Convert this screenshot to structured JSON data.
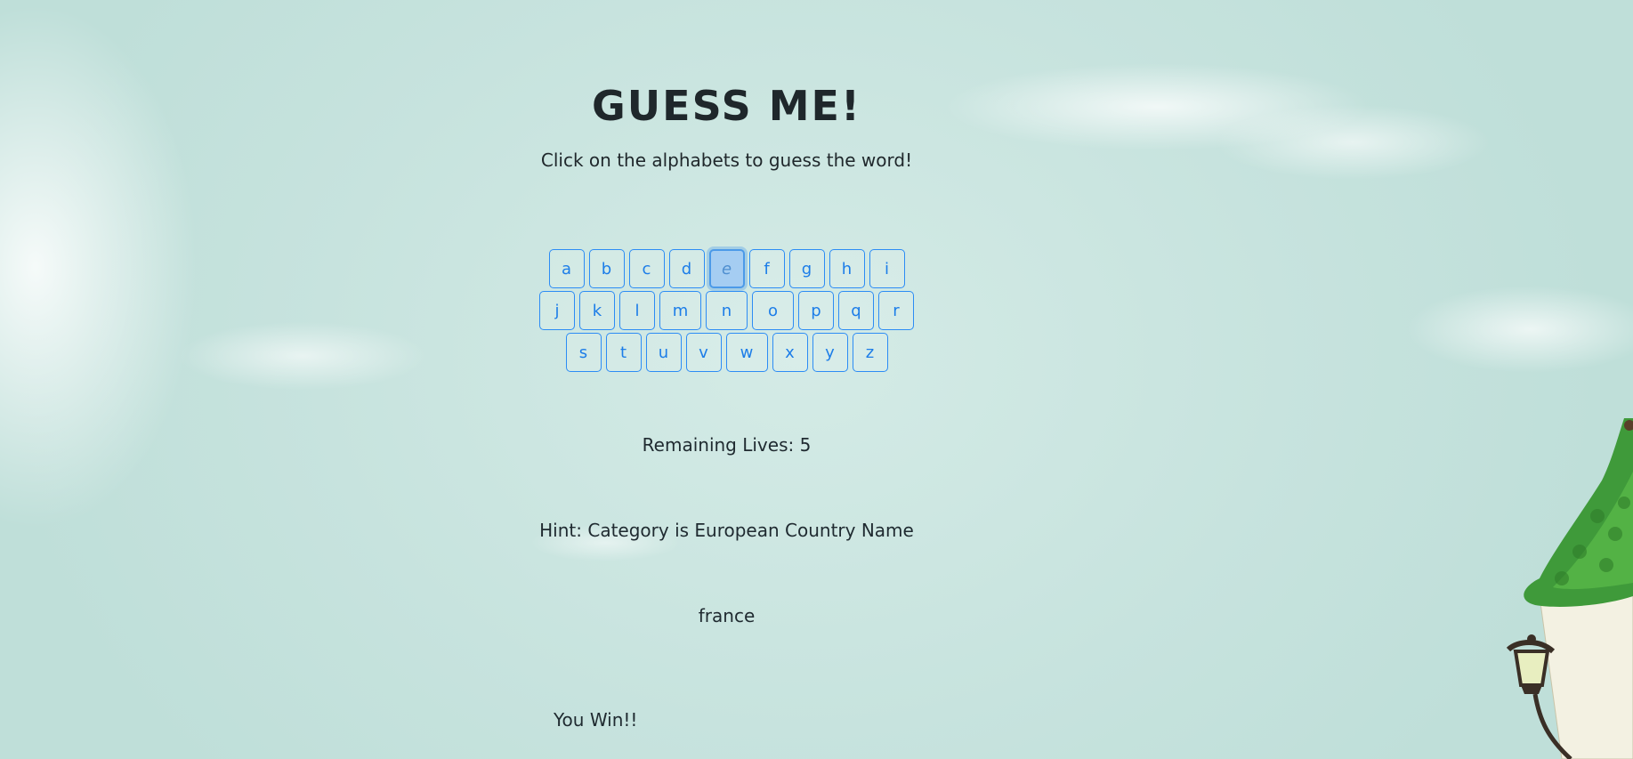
{
  "header": {
    "title": "GUESS ME!",
    "subtitle": "Click on the alphabets to guess the word!"
  },
  "keyboard": {
    "rows": [
      [
        "a",
        "b",
        "c",
        "d",
        "e",
        "f",
        "g",
        "h",
        "i"
      ],
      [
        "j",
        "k",
        "l",
        "m",
        "n",
        "o",
        "p",
        "q",
        "r"
      ],
      [
        "s",
        "t",
        "u",
        "v",
        "w",
        "x",
        "y",
        "z"
      ]
    ],
    "active_key": "e"
  },
  "status": {
    "lives_label": "Remaining Lives: 5",
    "hint": "Hint: Category is European Country Name",
    "word": "france",
    "result": "You Win!!"
  },
  "colors": {
    "key_border": "#2c8cf5",
    "key_text": "#1c7de8",
    "key_active_bg": "#a5cdf2",
    "background": "#c7e3de"
  },
  "icons": {
    "decoration": "house-with-lamp-icon"
  }
}
